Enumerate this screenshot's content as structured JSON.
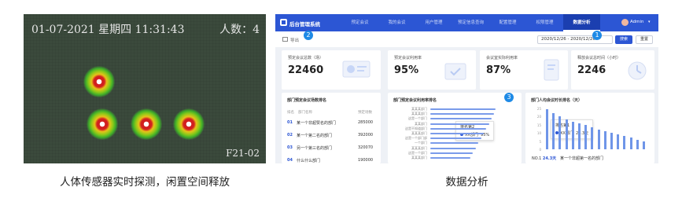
{
  "sensor": {
    "datetime": "01-07-2021 星期四 11:31:43",
    "count_label": "人数：",
    "count": "4",
    "panel_id": "F21-02"
  },
  "captions": {
    "left": "人体传感器实时探测，闲置空间释放",
    "right": "数据分析"
  },
  "dashboard": {
    "app_title": "后台管理系统",
    "nav": [
      "预定会议",
      "我的会议",
      "用户管理",
      "预定信息查询",
      "配置管理",
      "权限管理",
      "数据分析"
    ],
    "active_nav": "数据分析",
    "user": "Admin",
    "export_label": "导出",
    "date_range": "2020/12/26 - 2020/12/26",
    "search_label": "搜索",
    "reset_label": "重置",
    "callouts": [
      "1",
      "2",
      "3"
    ],
    "kpis": [
      {
        "title": "预定会议总数（场）",
        "value": "22460"
      },
      {
        "title": "预定会议利用率",
        "value": "95%"
      },
      {
        "title": "会议室实际利用率",
        "value": "87%"
      },
      {
        "title": "释放会议总时间（小时）",
        "value": "2246"
      }
    ],
    "dept_table": {
      "title": "部门预定会议场数排名",
      "headers": [
        "排名",
        "部门名称",
        "预定场数"
      ],
      "rows": [
        {
          "rank": "01",
          "name": "某一个非超赞名的部门",
          "value": "285000"
        },
        {
          "rank": "02",
          "name": "某一个第二名的部门",
          "value": "392000"
        },
        {
          "rank": "03",
          "name": "另一个第三名的部门",
          "value": "320070"
        },
        {
          "rank": "04",
          "name": "什么什么部门",
          "value": "190000"
        }
      ]
    },
    "utilization": {
      "title": "部门预定会议利用率排名",
      "labels": [
        "某某某部门",
        "某某某部门",
        "这是一个部门",
        "某某部门",
        "这是不知道部门",
        "某某某部门",
        "这是一个部门部",
        "一个部门",
        "某某某部门",
        "这是一个部门",
        "某某某部门"
      ],
      "tooltip_title": "排名第2",
      "tooltip_dept": "XX部门",
      "tooltip_value": "95%"
    },
    "avg_time": {
      "title": "部门人均会议时长排名（天）",
      "yticks": [
        "25",
        "20",
        "15",
        "10",
        "5",
        "0"
      ],
      "tooltip_title": "排名第1",
      "tooltip_dept": "XX部门",
      "tooltip_value": "24.3天",
      "no1_label": "NO.1",
      "no1_value": "24.3天",
      "no1_dept": "某一个非超第一名的部门"
    }
  },
  "chart_data": [
    {
      "type": "bar",
      "title": "部门预定会议利用率排名",
      "categories": [
        "某某某部门",
        "某某某部门",
        "这是一个部门",
        "某某部门",
        "这是不知道部门",
        "某某某部门",
        "这是一个部门部",
        "一个部门",
        "某某某部门",
        "这是一个部门",
        "某某某部门"
      ],
      "values": [
        98,
        95,
        92,
        88,
        84,
        80,
        76,
        72,
        68,
        64,
        60
      ],
      "orientation": "horizontal"
    },
    {
      "type": "bar",
      "title": "部门人均会议时长排名（天）",
      "values": [
        24.3,
        22,
        20,
        18.5,
        17,
        16,
        15,
        13.5,
        12,
        11,
        10,
        9,
        8,
        7,
        6,
        5
      ],
      "ylim": [
        0,
        25
      ]
    }
  ]
}
